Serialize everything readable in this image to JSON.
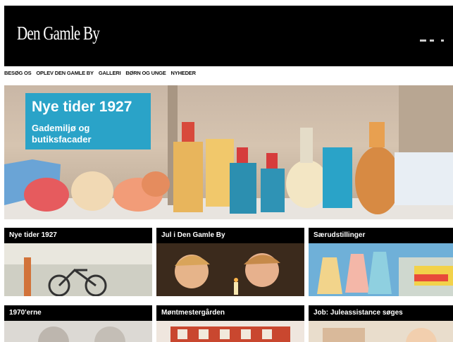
{
  "header": {
    "logo_text": "Den Gamle By"
  },
  "nav": {
    "items": [
      "BESØG OS",
      "OPLEV DEN GAMLE BY",
      "GALLERI",
      "BØRN OG UNGE",
      "NYHEDER"
    ]
  },
  "hero": {
    "title": "Nye tider 1927",
    "subtitle": "Gademiljø og butiksfacader",
    "accent_color": "#2aa3c8"
  },
  "tiles": [
    {
      "title": "Nye tider 1927"
    },
    {
      "title": "Jul i Den Gamle By"
    },
    {
      "title": "Særudstillinger"
    },
    {
      "title": "1970'erne"
    },
    {
      "title": "Møntmestergården"
    },
    {
      "title": "Job: Juleassistance søges"
    }
  ]
}
